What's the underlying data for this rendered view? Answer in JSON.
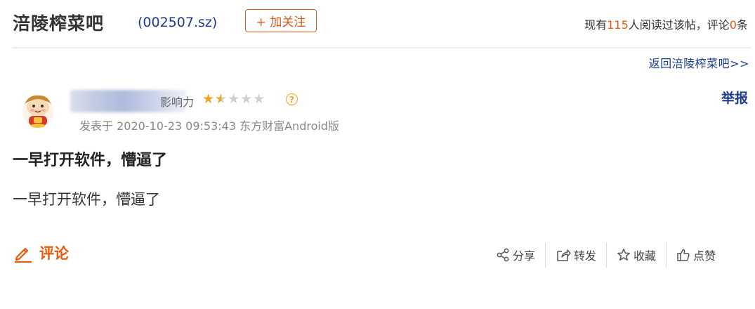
{
  "header": {
    "forum_name": "涪陵榨菜吧",
    "stock_code": "(002507.sz)",
    "follow_label": "+ 加关注",
    "stats": {
      "prefix": "现有",
      "read_count": "115",
      "middle": "人阅读过该帖，评论",
      "comment_count": "0",
      "suffix": "条"
    }
  },
  "nav": {
    "back_link": "返回涪陵榨菜吧>>"
  },
  "author": {
    "influence_label": "影响力",
    "rating": 1.5,
    "rating_max": 5,
    "report_label": "举报"
  },
  "post": {
    "meta": "发表于 2020-10-23 09:53:43 东方财富Android版",
    "title": "一早打开软件，懵逼了",
    "body": "一早打开软件，懵逼了"
  },
  "footer": {
    "comment_label": "评论",
    "actions": [
      {
        "label": "分享",
        "icon": "share-icon"
      },
      {
        "label": "转发",
        "icon": "forward-icon"
      },
      {
        "label": "收藏",
        "icon": "star-icon"
      },
      {
        "label": "点赞",
        "icon": "thumbs-up-icon"
      }
    ]
  },
  "colors": {
    "accent_orange": "#e85a0e",
    "link_blue": "#1b3c8f",
    "star_gold": "#f0a322"
  }
}
